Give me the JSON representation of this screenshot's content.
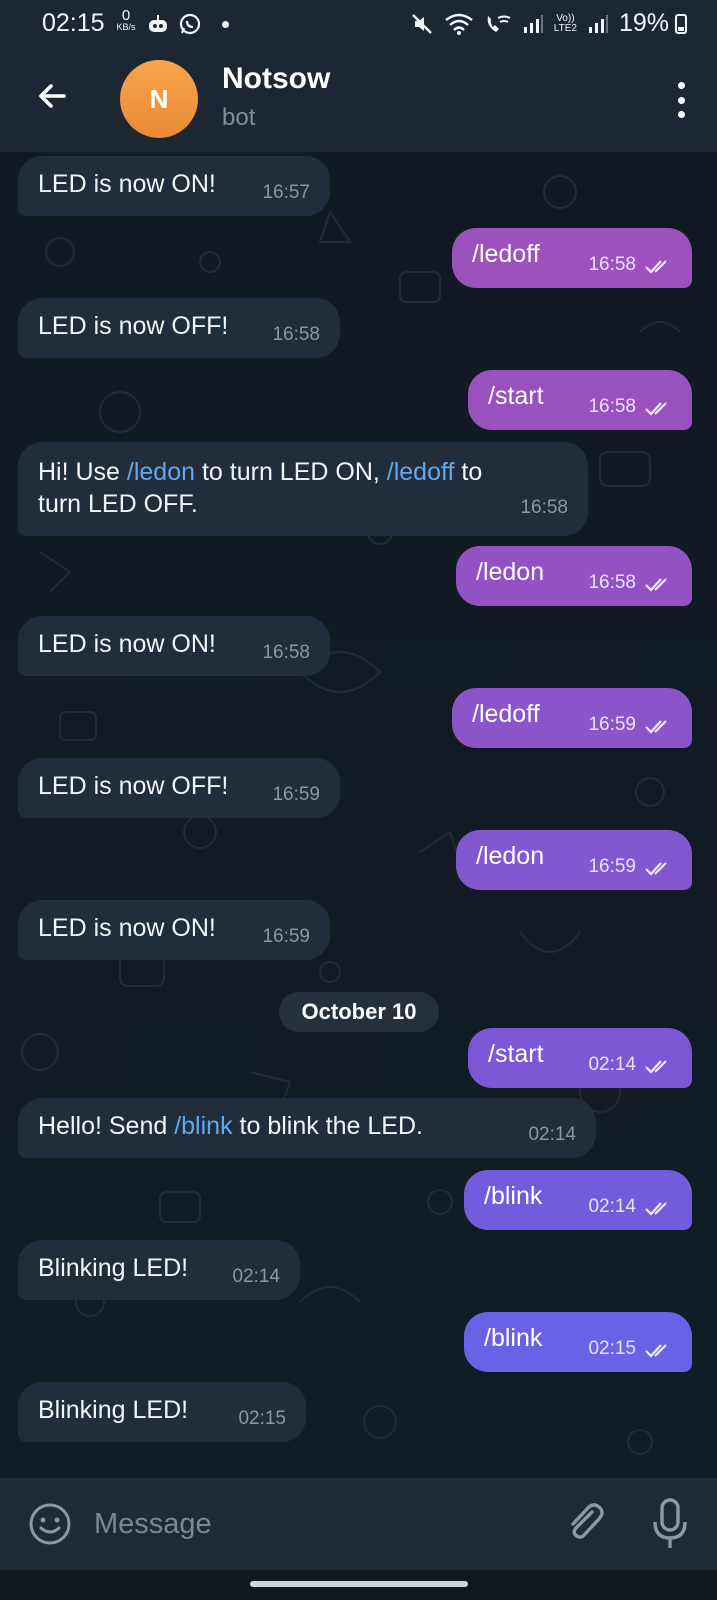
{
  "status": {
    "time": "02:15",
    "net_speed": "0",
    "net_unit": "KB/s",
    "volte": "Vo))",
    "lte": "LTE2",
    "battery": "19%"
  },
  "header": {
    "avatar_letter": "N",
    "name": "Notsow",
    "subtitle": "bot"
  },
  "messages": [
    {
      "text": "LED is now ON!",
      "time": "16:57"
    },
    {
      "text": "/ledoff",
      "time": "16:58"
    },
    {
      "text": "LED is now OFF!",
      "time": "16:58"
    },
    {
      "text": "/start",
      "time": "16:58"
    },
    {
      "parts": [
        "Hi! Use ",
        "/ledon",
        " to turn LED ON, ",
        "/ledoff",
        " to",
        "turn LED OFF."
      ],
      "time": "16:58"
    },
    {
      "text": "/ledon",
      "time": "16:58"
    },
    {
      "text": "LED is now ON!",
      "time": "16:58"
    },
    {
      "text": "/ledoff",
      "time": "16:59"
    },
    {
      "text": "LED is now OFF!",
      "time": "16:59"
    },
    {
      "text": "/ledon",
      "time": "16:59"
    },
    {
      "text": "LED is now ON!",
      "time": "16:59"
    },
    {
      "text": "/start",
      "time": "02:14"
    },
    {
      "parts": [
        "Hello! Send ",
        "/blink",
        " to blink the LED."
      ],
      "time": "02:14"
    },
    {
      "text": "/blink",
      "time": "02:14"
    },
    {
      "text": "Blinking LED!",
      "time": "02:14"
    },
    {
      "text": "/blink",
      "time": "02:15"
    },
    {
      "text": "Blinking LED!",
      "time": "02:15"
    }
  ],
  "date_separator": "October 10",
  "composer": {
    "placeholder": "Message"
  },
  "colors": {
    "outgoing_top": "#9b4fbf",
    "outgoing_bottom": "#6a67e8",
    "incoming": "#212d3b",
    "link": "#62a8ee",
    "header": "#1d2734"
  }
}
